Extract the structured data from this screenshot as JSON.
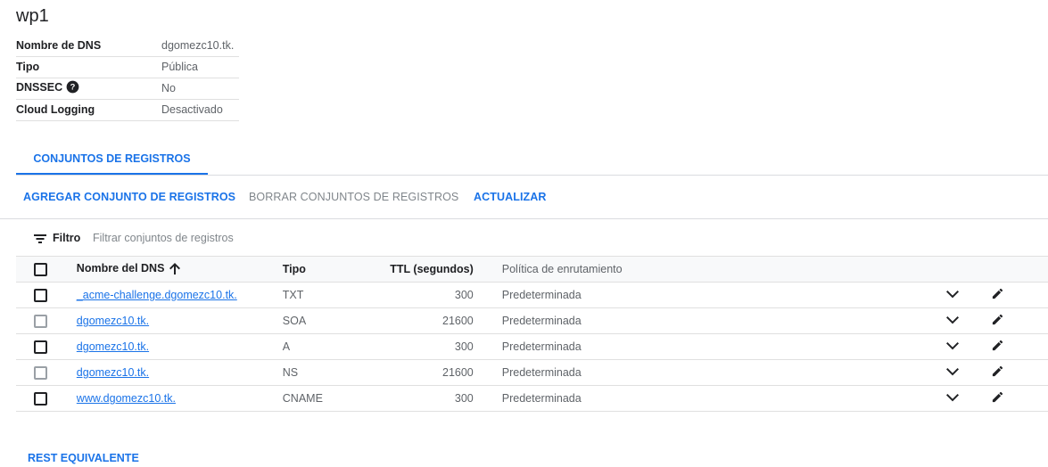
{
  "zone": {
    "title": "wp1"
  },
  "details": [
    {
      "label": "Nombre de DNS",
      "value": "dgomezc10.tk."
    },
    {
      "label": "Tipo",
      "value": "Pública"
    },
    {
      "label": "DNSSEC",
      "value": "No",
      "icon": "help-icon"
    },
    {
      "label": "Cloud Logging",
      "value": "Desactivado"
    }
  ],
  "tabs": [
    {
      "label": "CONJUNTOS DE REGISTROS",
      "active": true
    }
  ],
  "actions": {
    "add": "AGREGAR CONJUNTO DE REGISTROS",
    "delete": "BORRAR CONJUNTOS DE REGISTROS",
    "refresh": "ACTUALIZAR"
  },
  "filter": {
    "label": "Filtro",
    "placeholder": "Filtrar conjuntos de registros",
    "icon": "filter-list-icon"
  },
  "table": {
    "columns": {
      "name": "Nombre del DNS",
      "type": "Tipo",
      "ttl": "TTL (segundos)",
      "policy": "Política de enrutamiento"
    },
    "sort": {
      "column": "name",
      "direction": "ascending",
      "icon": "arrow-up-icon"
    },
    "rows": [
      {
        "name": "_acme-challenge.dgomezc10.tk.",
        "type": "TXT",
        "ttl": "300",
        "policy": "Predeterminada",
        "checkbox_enabled": true
      },
      {
        "name": "dgomezc10.tk.",
        "type": "SOA",
        "ttl": "21600",
        "policy": "Predeterminada",
        "checkbox_enabled": false
      },
      {
        "name": "dgomezc10.tk.",
        "type": "A",
        "ttl": "300",
        "policy": "Predeterminada",
        "checkbox_enabled": true
      },
      {
        "name": "dgomezc10.tk.",
        "type": "NS",
        "ttl": "21600",
        "policy": "Predeterminada",
        "checkbox_enabled": false
      },
      {
        "name": "www.dgomezc10.tk.",
        "type": "CNAME",
        "ttl": "300",
        "policy": "Predeterminada",
        "checkbox_enabled": true
      }
    ],
    "row_icons": {
      "expand": "chevron-down-icon",
      "edit": "pencil-icon"
    }
  },
  "footer": {
    "rest_link": "REST EQUIVALENTE"
  },
  "colors": {
    "accent": "#1a73e8",
    "text": "#202124",
    "secondary": "#5f6368",
    "divider": "#e0e0e0"
  }
}
